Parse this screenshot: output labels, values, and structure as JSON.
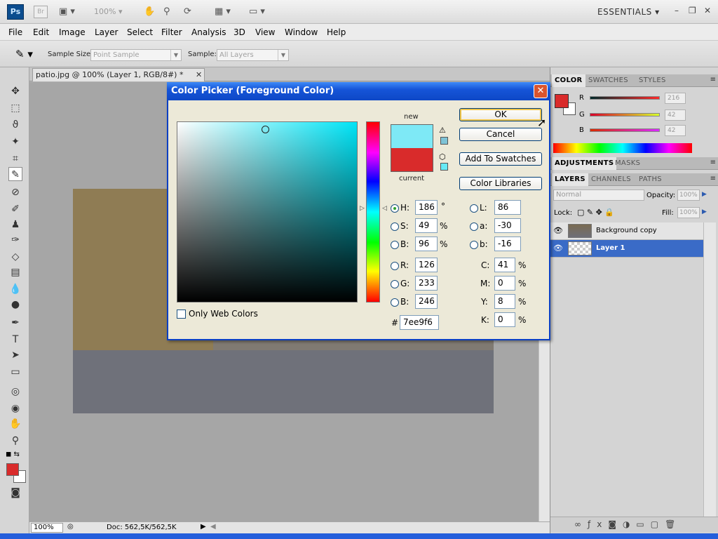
{
  "appbar": {
    "ps_logo": "Ps",
    "br_logo": "Br",
    "zoom": "100%",
    "workspace": "ESSENTIALS",
    "win_minimize": "–",
    "win_restore": "❐",
    "win_close": "✕"
  },
  "menu": [
    "File",
    "Edit",
    "Image",
    "Layer",
    "Select",
    "Filter",
    "Analysis",
    "3D",
    "View",
    "Window",
    "Help"
  ],
  "options": {
    "sample_size_label": "Sample Size:",
    "sample_size_value": "Point Sample",
    "sample_label": "Sample:",
    "sample_value": "All Layers"
  },
  "document": {
    "tab_title": "patio.jpg @ 100% (Layer 1, RGB/8#) *",
    "close": "✕",
    "status_zoom": "100%",
    "status_doc": "Doc: 562,5K/562,5K"
  },
  "color_panel": {
    "tabs": [
      "COLOR",
      "SWATCHES",
      "STYLES"
    ],
    "r_label": "R",
    "g_label": "G",
    "b_label": "B",
    "r_value": "216",
    "g_value": "42",
    "b_value": "42"
  },
  "adjustments_panel": {
    "tabs": [
      "ADJUSTMENTS",
      "MASKS"
    ]
  },
  "layers_panel": {
    "tabs": [
      "LAYERS",
      "CHANNELS",
      "PATHS"
    ],
    "blend_mode": "Normal",
    "opacity_label": "Opacity:",
    "opacity_value": "100%",
    "lock_label": "Lock:",
    "fill_label": "Fill:",
    "fill_value": "100%",
    "layers": [
      {
        "name": "Background copy",
        "selected": false
      },
      {
        "name": "Layer 1",
        "selected": true
      }
    ]
  },
  "color_picker": {
    "title": "Color Picker (Foreground Color)",
    "new_label": "new",
    "current_label": "current",
    "new_color": "#7ee9f6",
    "current_color": "#d92b2b",
    "buttons": {
      "ok": "OK",
      "cancel": "Cancel",
      "add_to_swatches": "Add To Swatches",
      "color_libraries": "Color Libraries"
    },
    "hsb": {
      "h": "186",
      "s": "49",
      "b": "96"
    },
    "rgb": {
      "r": "126",
      "g": "233",
      "b": "246"
    },
    "lab": {
      "l": "86",
      "a": "-30",
      "b": "-16"
    },
    "cmyk": {
      "c": "41",
      "m": "0",
      "y": "8",
      "k": "0"
    },
    "labels": {
      "h": "H:",
      "s": "S:",
      "b": "B:",
      "r": "R:",
      "g": "G:",
      "b2": "B:",
      "l": "L:",
      "a": "a:",
      "lb": "b:",
      "c": "C:",
      "m": "M:",
      "y": "Y:",
      "k": "K:",
      "hash": "#"
    },
    "units": {
      "degree": "°",
      "percent": "%"
    },
    "hex": "7ee9f6",
    "only_web_colors": "Only Web Colors"
  }
}
